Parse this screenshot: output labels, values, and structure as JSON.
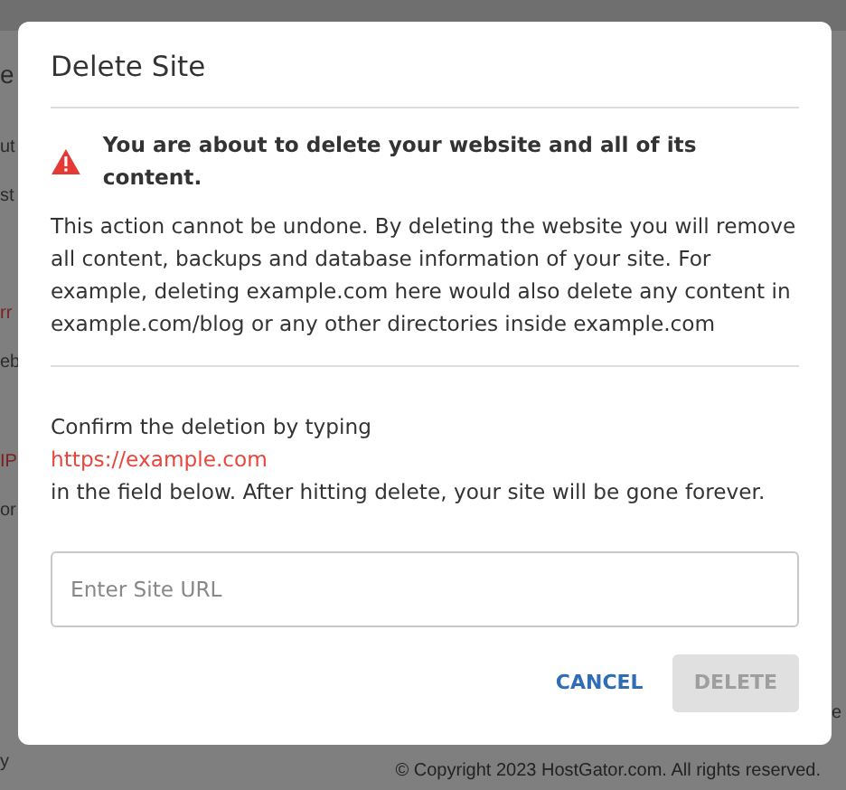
{
  "background": {
    "fragments": [
      {
        "text": "e",
        "kind": "heading"
      },
      {
        "text": "ut",
        "kind": "plain"
      },
      {
        "text": "st",
        "kind": "plain"
      },
      {
        "text": "rr",
        "kind": "alert"
      },
      {
        "text": "eb",
        "kind": "plain"
      },
      {
        "text": "IP",
        "kind": "alert"
      },
      {
        "text": "or",
        "kind": "plain"
      },
      {
        "text": "y",
        "kind": "plain"
      }
    ],
    "right_fragment": "e",
    "footer": "© Copyright 2023 HostGator.com. All rights reserved."
  },
  "dialog": {
    "title": "Delete Site",
    "warning": "You are about to delete your website and all of its content.",
    "description": "This action cannot be undone. By deleting the website you will remove all content, backups and database information of your site. For example, deleting example.com here would also delete any content in example.com/blog or any other directories inside example.com",
    "confirm_lines": [
      {
        "text": "Confirm the deletion by typing",
        "kind": "plain"
      },
      {
        "text": "https://example.com",
        "kind": "url"
      },
      {
        "text": "in the field below. After hitting delete, your site will be gone forever.",
        "kind": "plain"
      }
    ],
    "field": {
      "placeholder": "Enter Site URL"
    },
    "buttons": [
      {
        "label": "CANCEL",
        "kind": "link",
        "disabled": false
      },
      {
        "label": "DELETE",
        "kind": "solid",
        "disabled": true
      }
    ]
  }
}
